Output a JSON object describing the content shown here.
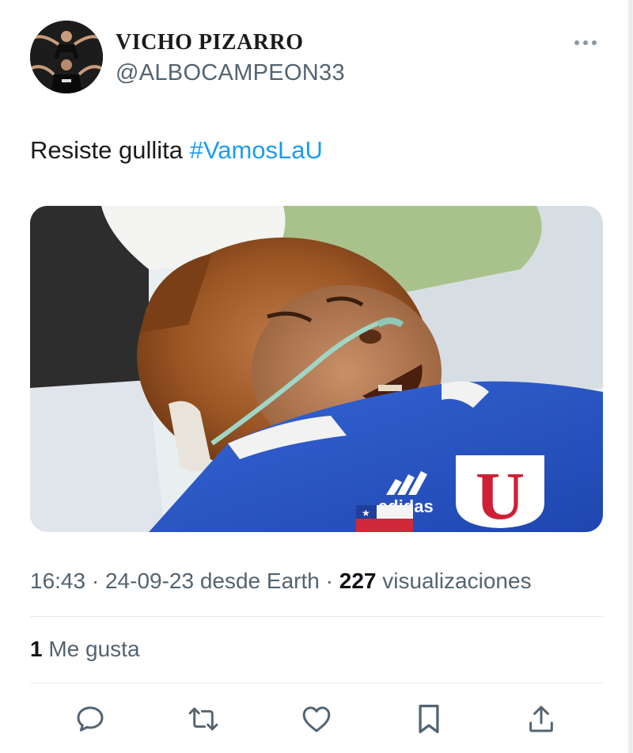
{
  "tweet": {
    "display_name": "VICHO PIZARRO",
    "handle": "@ALBOCAMPEON33",
    "text": "Resiste gullita",
    "hashtag": "#VamosLaU",
    "time": "16:43",
    "date": "24-09-23",
    "source_prefix": "desde",
    "source": "Earth",
    "views_count": "227",
    "views_label": "visualizaciones",
    "likes_count": "1",
    "likes_label": "Me gusta"
  },
  "media": {
    "shirt_brand": "adidas",
    "crest_letter": "U"
  },
  "icons": {
    "more": "more-dots-icon",
    "reply": "reply-bubble-icon",
    "retweet": "retweet-icon",
    "like": "heart-icon",
    "bookmark": "bookmark-icon",
    "share": "share-upload-icon"
  },
  "colors": {
    "hashtag": "#1d9bf0",
    "secondary_text": "#536471",
    "icon": "#536471",
    "shirt_blue": "#2a57c9",
    "crest_red": "#cf1f35"
  }
}
